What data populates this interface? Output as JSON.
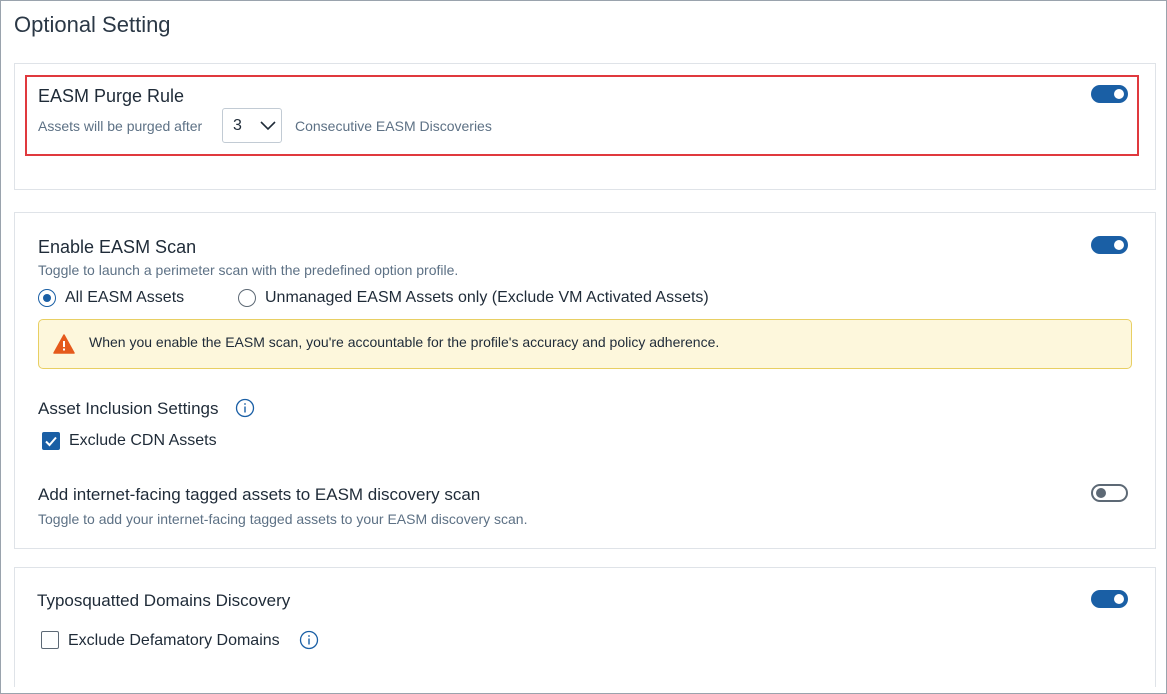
{
  "page": {
    "title": "Optional Setting"
  },
  "purge_rule": {
    "title": "EASM Purge Rule",
    "prefix": "Assets will be purged after",
    "selected_value": "3",
    "suffix": "Consecutive EASM Discoveries",
    "enabled": true
  },
  "easm_scan": {
    "title": "Enable EASM Scan",
    "description": "Toggle to launch a perimeter scan with the predefined option profile.",
    "enabled": true,
    "options": [
      {
        "label": "All EASM Assets",
        "selected": true
      },
      {
        "label": "Unmanaged EASM Assets only (Exclude VM Activated Assets)",
        "selected": false
      }
    ],
    "warning": "When you enable the EASM scan, you're accountable for the profile's accuracy and policy adherence.",
    "inclusion": {
      "title": "Asset Inclusion Settings",
      "exclude_cdn_label": "Exclude CDN Assets",
      "exclude_cdn_checked": true
    },
    "internet_facing": {
      "title": "Add internet-facing tagged assets to EASM discovery scan",
      "description": "Toggle to add your internet-facing tagged assets to your EASM discovery scan.",
      "enabled": false
    }
  },
  "typosquatted": {
    "title": "Typosquatted Domains Discovery",
    "enabled": true,
    "exclude_defamatory_label": "Exclude Defamatory Domains",
    "exclude_defamatory_checked": false
  },
  "colors": {
    "accent": "#1a5fa5",
    "highlight_border": "#e0393e",
    "warning_bg": "#fdf7dc",
    "warning_icon": "#e55a1c"
  },
  "icons": {
    "select_chevron": "chevron-down-icon",
    "warning": "warning-triangle-icon",
    "info": "info-circle-icon",
    "checkmark": "checkmark-icon"
  }
}
